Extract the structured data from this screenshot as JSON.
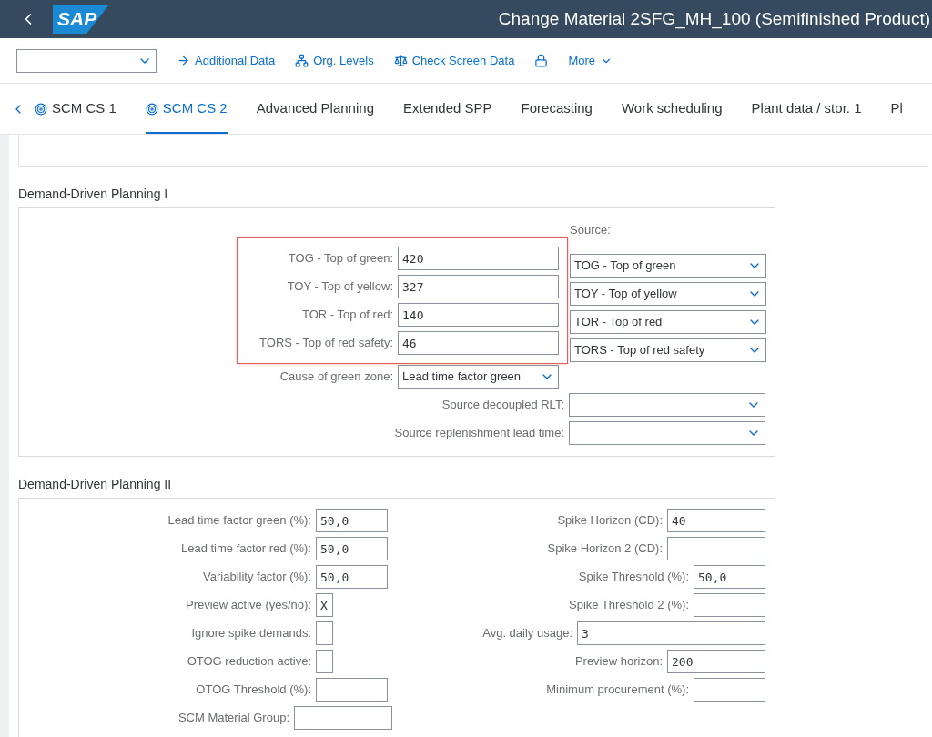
{
  "header": {
    "logo": "SAP",
    "title": "Change Material 2SFG_MH_100 (Semifinished Product)"
  },
  "toolbar": {
    "items": [
      {
        "kind": "arrow",
        "label": "Additional Data"
      },
      {
        "kind": "hierarchy",
        "label": "Org. Levels"
      },
      {
        "kind": "scale",
        "label": "Check Screen Data"
      },
      {
        "kind": "lock"
      },
      {
        "kind": "menu",
        "label": "More"
      }
    ]
  },
  "tabs": [
    {
      "label": "SCM CS 1",
      "selected": false,
      "kind": "flagged"
    },
    {
      "label": "SCM CS 2",
      "selected": true,
      "kind": "flagged"
    },
    {
      "label": "Advanced Planning",
      "selected": false,
      "kind": "plain"
    },
    {
      "label": "Extended SPP",
      "selected": false,
      "kind": "plain"
    },
    {
      "label": "Forecasting",
      "selected": false,
      "kind": "plain"
    },
    {
      "label": "Work scheduling",
      "selected": false,
      "kind": "plain"
    },
    {
      "label": "Plant data / stor. 1",
      "selected": false,
      "kind": "plain"
    },
    {
      "label": "Pl",
      "selected": false,
      "kind": "plain"
    }
  ],
  "ddp1": {
    "title": "Demand-Driven Planning I",
    "source_label": "Source:",
    "highlight": true,
    "buffers": [
      {
        "label": "TOG - Top of green:",
        "value": "420",
        "source": "TOG - Top of green"
      },
      {
        "label": "TOY - Top of yellow:",
        "value": "327",
        "source": "TOY - Top of yellow"
      },
      {
        "label": "TOR - Top of red:",
        "value": "140",
        "source": "TOR - Top of red"
      },
      {
        "label": "TORS - Top of red safety:",
        "value": "46",
        "source": "TORS - Top of red safety"
      }
    ],
    "cause": {
      "label": "Cause of green zone:",
      "value": "Lead time factor green"
    },
    "sources": [
      {
        "label": "Source decoupled RLT:"
      },
      {
        "label": "Source replenishment lead time:"
      }
    ]
  },
  "ddp2": {
    "title": "Demand-Driven Planning II",
    "left": [
      {
        "label": "Lead time factor green (%):",
        "value": "50,0",
        "kind": "short"
      },
      {
        "label": "Lead time factor red (%):",
        "value": "50,0",
        "kind": "short"
      },
      {
        "label": "Variability factor (%):",
        "value": "50,0",
        "kind": "short"
      },
      {
        "label": "Preview active (yes/no):",
        "value": "X",
        "kind": "tiny"
      },
      {
        "label": "Ignore spike demands:",
        "kind": "tiny"
      },
      {
        "label": "OTOG reduction active:",
        "kind": "tiny"
      },
      {
        "label": "OTOG Threshold (%):",
        "kind": "short"
      },
      {
        "label": "SCM Material Group:",
        "kind": "medium"
      }
    ],
    "right": [
      {
        "label": "Spike Horizon (CD):",
        "value": "40",
        "kind": "medium"
      },
      {
        "label": "Spike Horizon 2 (CD):",
        "kind": "medium"
      },
      {
        "label": "Spike Threshold (%):",
        "value": "50,0",
        "kind": "short"
      },
      {
        "label": "Spike Threshold 2 (%):",
        "kind": "short"
      },
      {
        "label": "Avg. daily usage:",
        "value": "3",
        "kind": "long"
      },
      {
        "label": "Preview horizon:",
        "value": "200",
        "kind": "medium"
      },
      {
        "label": "Minimum procurement (%):",
        "kind": "short"
      }
    ]
  }
}
